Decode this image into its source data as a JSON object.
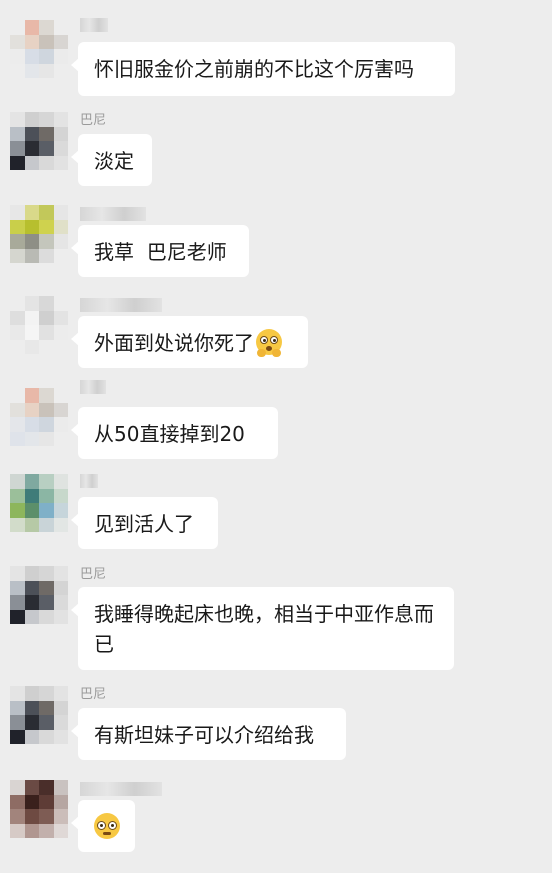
{
  "chat": {
    "messages": [
      {
        "sender": "",
        "text": "怀旧服金价之前崩的不比这个厉害吗"
      },
      {
        "sender": "巴尼",
        "text": "淡定"
      },
      {
        "sender": "",
        "text": "我草  巴尼老师"
      },
      {
        "sender": "",
        "text": "外面到处说你死了",
        "emoji": "face-holding-back-tears-emoji"
      },
      {
        "sender": "",
        "text": "从50直接掉到20"
      },
      {
        "sender": "",
        "text": "见到活人了"
      },
      {
        "sender": "巴尼",
        "text": "我睡得晚起床也晚，相当于中亚作息而已"
      },
      {
        "sender": "巴尼",
        "text": "有斯坦妹子可以介绍给我"
      },
      {
        "sender": "",
        "text": "",
        "emoji": "flushed-face-emoji"
      }
    ]
  },
  "colors": {
    "background": "#ededed",
    "bubble": "#ffffff",
    "text": "#191919",
    "sender_name": "#9a9a9a"
  }
}
